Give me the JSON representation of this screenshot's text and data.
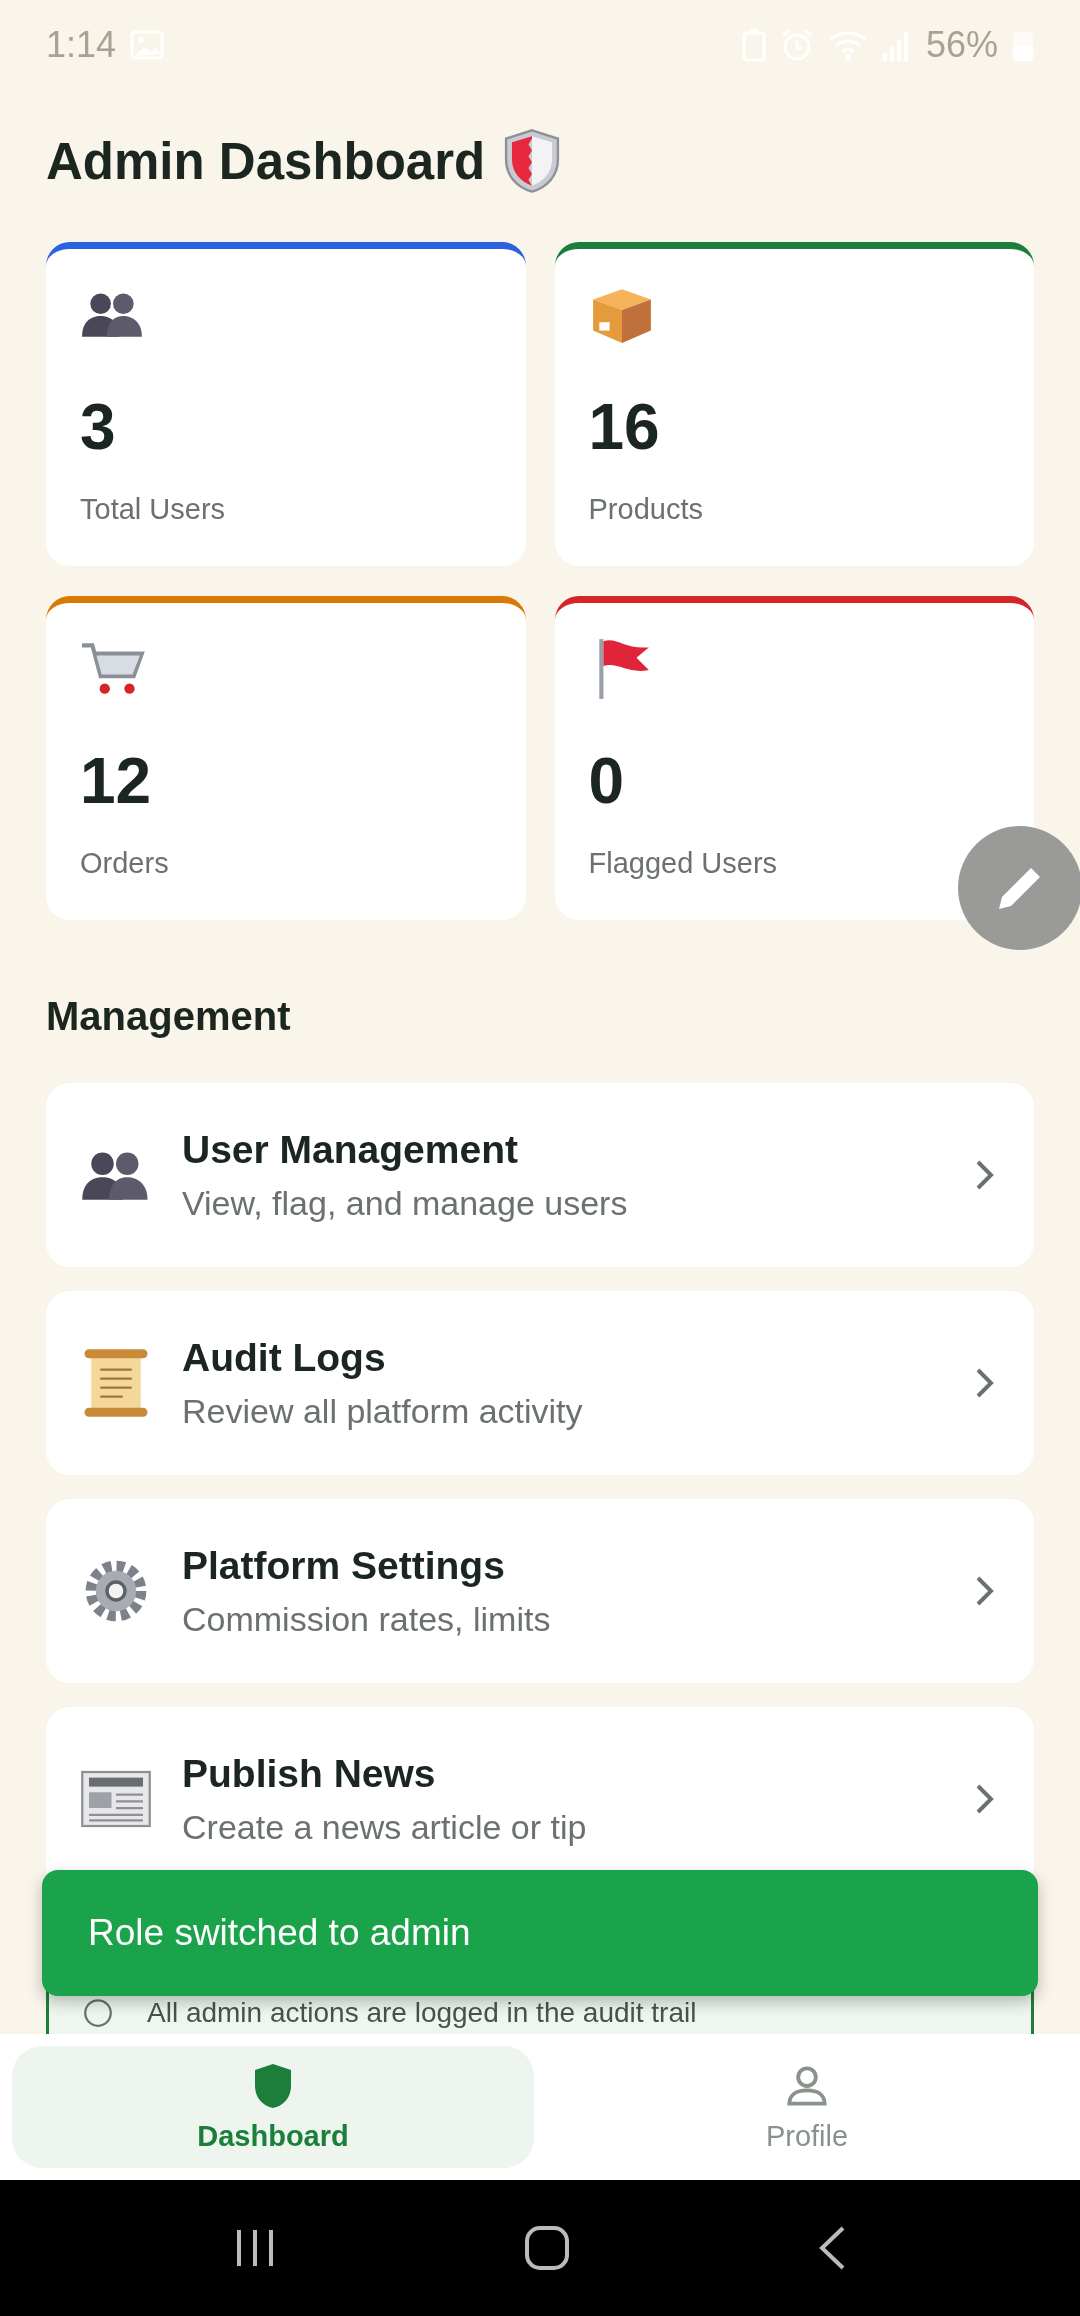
{
  "status_bar": {
    "time": "1:14",
    "battery": "56%"
  },
  "title": "Admin Dashboard",
  "stats": [
    {
      "kind": "users",
      "value": "3",
      "label": "Total Users",
      "color": "#2a62e0"
    },
    {
      "kind": "products",
      "value": "16",
      "label": "Products",
      "color": "#1b7f3b"
    },
    {
      "kind": "orders",
      "value": "12",
      "label": "Orders",
      "color": "#d97a06"
    },
    {
      "kind": "flags",
      "value": "0",
      "label": "Flagged Users",
      "color": "#d42626"
    }
  ],
  "section_title": "Management",
  "management": [
    {
      "kind": "users",
      "title": "User Management",
      "subtitle": "View, flag, and manage users"
    },
    {
      "kind": "logs",
      "title": "Audit Logs",
      "subtitle": "Review all platform activity"
    },
    {
      "kind": "settings",
      "title": "Platform Settings",
      "subtitle": "Commission rates, limits"
    },
    {
      "kind": "news",
      "title": "Publish News",
      "subtitle": "Create a news article or tip"
    }
  ],
  "notice": {
    "text": "All admin actions are logged in the audit trail"
  },
  "snackbar": {
    "message": "Role switched to admin"
  },
  "bottom_nav": [
    {
      "kind": "shield",
      "label": "Dashboard",
      "selected": true
    },
    {
      "kind": "person",
      "label": "Profile",
      "selected": false
    }
  ]
}
